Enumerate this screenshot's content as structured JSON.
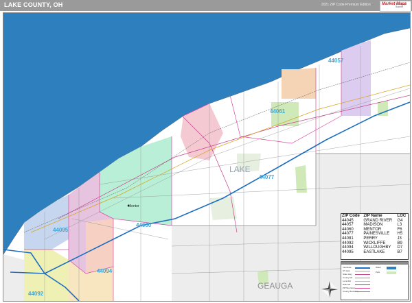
{
  "header": {
    "title": "LAKE COUNTY, OH",
    "edition": "2021 ZIP Code Premium Edition",
    "logo_mark": "Market Maps",
    "logo_sub": "Your Map Source"
  },
  "map": {
    "county_label": "LAKE",
    "neighbor_label": "GEAUGA",
    "city_label": "Mentor",
    "zip_labels": [
      "44057",
      "44061",
      "44077",
      "44060",
      "44095",
      "44094",
      "44092"
    ],
    "water_color": "#2e7fbd",
    "land_color": "#ffffff",
    "highway_color": "#1e6fc0"
  },
  "legend": {
    "headers": [
      "ZIP Code",
      "ZIP Name",
      "LOC"
    ],
    "rows": [
      [
        "44045",
        "GRAND RIVER",
        "G4"
      ],
      [
        "44057",
        "MADISON",
        "L3"
      ],
      [
        "44060",
        "MENTOR",
        "F6"
      ],
      [
        "44077",
        "PAINESVILLE",
        "H5"
      ],
      [
        "44081",
        "PERRY",
        "J3"
      ],
      [
        "44092",
        "WICKLIFFE",
        "B9"
      ],
      [
        "44094",
        "WILLOUGHBY",
        "D7"
      ],
      [
        "44095",
        "EASTLAKE",
        "B7"
      ]
    ]
  },
  "key": {
    "items": [
      "Interstate",
      "US Hwy",
      "State Hwy",
      "County Rd",
      "Local Rd",
      "Railroad",
      "ZIP Boundary",
      "County Boundary",
      "Water",
      "Park"
    ]
  }
}
